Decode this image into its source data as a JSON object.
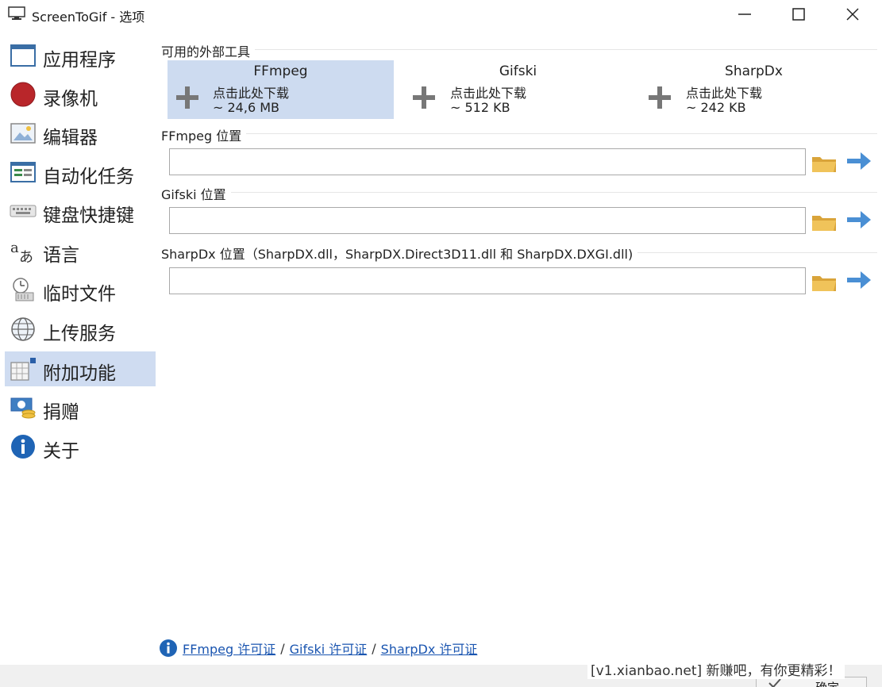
{
  "window": {
    "title": "ScreenToGif - 选项",
    "icons": [
      "monitor-icon",
      "minimize-icon",
      "maximize-icon",
      "close-icon"
    ]
  },
  "sidebar": {
    "items": [
      {
        "label": "应用程序",
        "icon": "window-icon"
      },
      {
        "label": "录像机",
        "icon": "record-icon"
      },
      {
        "label": "编辑器",
        "icon": "image-editor-icon"
      },
      {
        "label": "自动化任务",
        "icon": "tasks-icon"
      },
      {
        "label": "键盘快捷键",
        "icon": "keyboard-icon"
      },
      {
        "label": "语言",
        "icon": "language-icon"
      },
      {
        "label": "临时文件",
        "icon": "temp-files-icon"
      },
      {
        "label": "上传服务",
        "icon": "globe-icon"
      },
      {
        "label": "附加功能",
        "icon": "extras-icon",
        "active": true
      },
      {
        "label": "捐赠",
        "icon": "donate-icon"
      },
      {
        "label": "关于",
        "icon": "info-icon"
      }
    ]
  },
  "main": {
    "tools_title": "可用的外部工具",
    "tools": [
      {
        "name": "FFmpeg",
        "action": "点击此处下载",
        "size": "~ 24,6 MB",
        "highlighted": true
      },
      {
        "name": "Gifski",
        "action": "点击此处下载",
        "size": "~ 512 KB"
      },
      {
        "name": "SharpDx",
        "action": "点击此处下载",
        "size": "~ 242 KB"
      }
    ],
    "locations": [
      {
        "label": "FFmpeg 位置",
        "value": ""
      },
      {
        "label": "Gifski 位置",
        "value": ""
      },
      {
        "label": "SharpDx 位置（SharpDX.dll，SharpDX.Direct3D11.dll 和 SharpDX.DXGI.dll)",
        "value": ""
      }
    ]
  },
  "footer": {
    "links": [
      "FFmpeg 许可证",
      "Gifski 许可证",
      "SharpDx 许可证"
    ],
    "separator": "/"
  },
  "watermark": "[v1.xianbao.net] 新赚吧，有你更精彩！",
  "ok_button": "确定",
  "colors": {
    "active_bg": "#cfdcf1",
    "tool_highlight": "#cddbf0",
    "link": "#1a55b0",
    "arrow": "#4a8fd4",
    "folder": "#e8b84a"
  }
}
